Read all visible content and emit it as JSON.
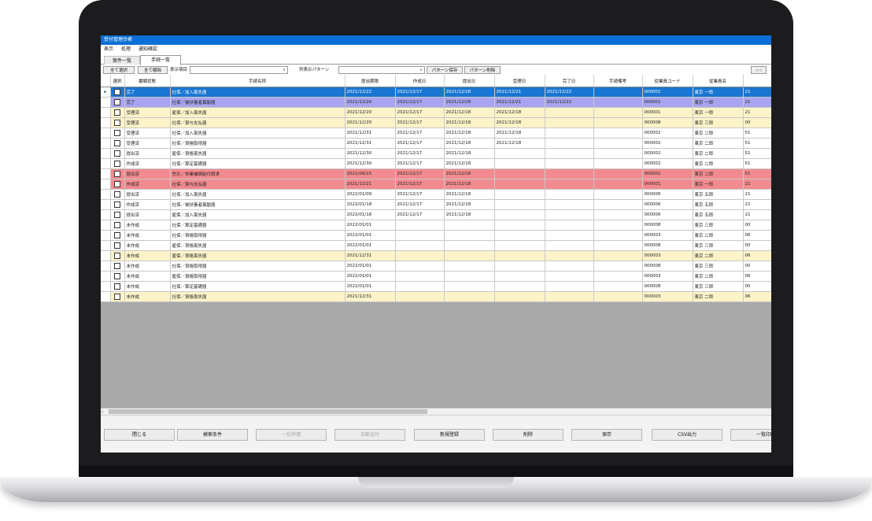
{
  "app": {
    "title": "受付管理台帳"
  },
  "menu": [
    "表示",
    "処理",
    "通知確認"
  ],
  "tabs": [
    {
      "label": "案件一覧",
      "active": false
    },
    {
      "label": "手続一覧",
      "active": true
    }
  ],
  "toolbar": {
    "select_all": "全て選択",
    "deselect_all": "全て解除",
    "display_item_label": "表示項目",
    "display_item_value": "",
    "column_pattern_label": "列表示パターン",
    "column_pattern_value": "",
    "save_pattern": "パターン保存",
    "delete_pattern": "パターン削除",
    "right_button": "<<"
  },
  "grid": {
    "columns": [
      "選択",
      "書類状態",
      "手続名称",
      "提出期限",
      "作成日",
      "提出日",
      "受理日",
      "完了日",
      "手続備考",
      "従業員コード",
      "従業員名",
      ""
    ],
    "rows": [
      {
        "style": "blue",
        "indicator": "▸",
        "status": "完了",
        "procedure": "社保／加入喪失届",
        "deadline": "2021/12/22",
        "created": "2021/12/17",
        "submitted": "2021/12/18",
        "accepted": "2021/12/21",
        "completed": "2021/12/22",
        "note": "",
        "code": "000001",
        "name": "東京 一郎",
        "extra": "21"
      },
      {
        "style": "purple",
        "indicator": "",
        "status": "完了",
        "procedure": "社保／被扶養者異動届",
        "deadline": "2021/12/20",
        "created": "2021/12/17",
        "submitted": "2021/12/18",
        "accepted": "2021/12/21",
        "completed": "2021/12/22",
        "note": "",
        "code": "000001",
        "name": "東京 一郎",
        "extra": "21"
      },
      {
        "style": "yellow",
        "indicator": "",
        "status": "受理済",
        "procedure": "雇保／加入喪失届",
        "deadline": "2021/12/20",
        "created": "2021/12/17",
        "submitted": "2021/12/18",
        "accepted": "2021/12/18",
        "completed": "",
        "note": "",
        "code": "000001",
        "name": "東京 一郎",
        "extra": "21"
      },
      {
        "style": "yellow",
        "indicator": "",
        "status": "受理済",
        "procedure": "社保／賞与支払届",
        "deadline": "2021/12/20",
        "created": "2021/12/17",
        "submitted": "2021/12/18",
        "accepted": "2021/12/18",
        "completed": "",
        "note": "",
        "code": "000008",
        "name": "東京 三郎",
        "extra": "00"
      },
      {
        "style": "white",
        "indicator": "",
        "status": "受理済",
        "procedure": "社保／加入喪失届",
        "deadline": "2021/12/31",
        "created": "2021/12/17",
        "submitted": "2021/12/18",
        "accepted": "2021/12/18",
        "completed": "",
        "note": "",
        "code": "000002",
        "name": "東京 二郎",
        "extra": "51"
      },
      {
        "style": "white",
        "indicator": "",
        "status": "受理済",
        "procedure": "社保／資格取得届",
        "deadline": "2021/12/31",
        "created": "2021/12/17",
        "submitted": "2021/12/18",
        "accepted": "2021/12/18",
        "completed": "",
        "note": "",
        "code": "000002",
        "name": "東京 二郎",
        "extra": "51"
      },
      {
        "style": "white",
        "indicator": "",
        "status": "提出済",
        "procedure": "雇保／資格喪失届",
        "deadline": "2021/12/30",
        "created": "2021/12/17",
        "submitted": "2021/12/18",
        "accepted": "",
        "completed": "",
        "note": "",
        "code": "000002",
        "name": "東京 二郎",
        "extra": "51"
      },
      {
        "style": "white",
        "indicator": "",
        "status": "作成済",
        "procedure": "社保／算定基礎届",
        "deadline": "2021/12/30",
        "created": "2021/12/17",
        "submitted": "2021/12/18",
        "accepted": "",
        "completed": "",
        "note": "",
        "code": "000002",
        "name": "東京 二郎",
        "extra": "51"
      },
      {
        "style": "red",
        "indicator": "",
        "status": "提出済",
        "procedure": "労災／休業補償給付請求",
        "deadline": "2021/09/15",
        "created": "2021/12/17",
        "submitted": "2021/12/18",
        "accepted": "",
        "completed": "",
        "note": "",
        "code": "000002",
        "name": "東京 二郎",
        "extra": "51"
      },
      {
        "style": "red",
        "indicator": "",
        "status": "作成済",
        "procedure": "社保／賞与支払届",
        "deadline": "2021/12/21",
        "created": "2021/12/17",
        "submitted": "2021/12/18",
        "accepted": "",
        "completed": "",
        "note": "",
        "code": "000001",
        "name": "東京 一郎",
        "extra": "21"
      },
      {
        "style": "white",
        "indicator": "",
        "status": "提出済",
        "procedure": "社保／加入喪失届",
        "deadline": "2022/01/09",
        "created": "2021/12/17",
        "submitted": "2021/12/18",
        "accepted": "",
        "completed": "",
        "note": "",
        "code": "000006",
        "name": "東京 五郎",
        "extra": "21"
      },
      {
        "style": "white",
        "indicator": "",
        "status": "作成済",
        "procedure": "社保／被扶養者異動届",
        "deadline": "2022/01/18",
        "created": "2021/12/17",
        "submitted": "2021/12/18",
        "accepted": "",
        "completed": "",
        "note": "",
        "code": "000006",
        "name": "東京 五郎",
        "extra": "21"
      },
      {
        "style": "white",
        "indicator": "",
        "status": "提出済",
        "procedure": "雇保／加入喪失届",
        "deadline": "2022/01/18",
        "created": "2021/12/17",
        "submitted": "2021/12/18",
        "accepted": "",
        "completed": "",
        "note": "",
        "code": "000006",
        "name": "東京 五郎",
        "extra": "21"
      },
      {
        "style": "white",
        "indicator": "",
        "status": "未作成",
        "procedure": "社保／算定基礎届",
        "deadline": "2022/01/01",
        "created": "",
        "submitted": "",
        "accepted": "",
        "completed": "",
        "note": "",
        "code": "000008",
        "name": "東京 三郎",
        "extra": "00"
      },
      {
        "style": "white",
        "indicator": "",
        "status": "未作成",
        "procedure": "社保／資格取得届",
        "deadline": "2022/01/01",
        "created": "",
        "submitted": "",
        "accepted": "",
        "completed": "",
        "note": "",
        "code": "000003",
        "name": "東京 二郎",
        "extra": "06"
      },
      {
        "style": "white",
        "indicator": "",
        "status": "未作成",
        "procedure": "雇保／資格喪失届",
        "deadline": "2022/01/01",
        "created": "",
        "submitted": "",
        "accepted": "",
        "completed": "",
        "note": "",
        "code": "000008",
        "name": "東京 三郎",
        "extra": "00"
      },
      {
        "style": "yellow",
        "indicator": "",
        "status": "未作成",
        "procedure": "雇保／資格喪失届",
        "deadline": "2021/12/31",
        "created": "",
        "submitted": "",
        "accepted": "",
        "completed": "",
        "note": "",
        "code": "000003",
        "name": "東京 二郎",
        "extra": "06"
      },
      {
        "style": "white",
        "indicator": "",
        "status": "未作成",
        "procedure": "社保／資格取得届",
        "deadline": "2022/01/01",
        "created": "",
        "submitted": "",
        "accepted": "",
        "completed": "",
        "note": "",
        "code": "000008",
        "name": "東京 三郎",
        "extra": "00"
      },
      {
        "style": "white",
        "indicator": "",
        "status": "未作成",
        "procedure": "雇保／資格取得届",
        "deadline": "2022/01/01",
        "created": "",
        "submitted": "",
        "accepted": "",
        "completed": "",
        "note": "",
        "code": "000003",
        "name": "東京 二郎",
        "extra": "06"
      },
      {
        "style": "white",
        "indicator": "",
        "status": "未作成",
        "procedure": "社保／算定基礎届",
        "deadline": "2022/01/01",
        "created": "",
        "submitted": "",
        "accepted": "",
        "completed": "",
        "note": "",
        "code": "000008",
        "name": "東京 三郎",
        "extra": "00"
      },
      {
        "style": "yellow",
        "indicator": "",
        "status": "未作成",
        "procedure": "社保／資格喪失届",
        "deadline": "2021/12/31",
        "created": "",
        "submitted": "",
        "accepted": "",
        "completed": "",
        "note": "",
        "code": "000003",
        "name": "東京 二郎",
        "extra": "06"
      }
    ]
  },
  "footer_buttons": [
    {
      "label": "閉じる",
      "enabled": true
    },
    {
      "label": "検索条件",
      "enabled": true
    },
    {
      "label": "一括申請",
      "enabled": false
    },
    {
      "label": "自動送付",
      "enabled": false
    },
    {
      "label": "新規登録",
      "enabled": true
    },
    {
      "label": "削除",
      "enabled": true
    },
    {
      "label": "保存",
      "enabled": true
    },
    {
      "label": "CSV出力",
      "enabled": true
    },
    {
      "label": "一覧印刷",
      "enabled": true
    }
  ],
  "colors": {
    "titlebar": "#0b6fd6",
    "row_blue": "#1976d2",
    "row_purple": "#a9a4ef",
    "row_yellow": "#fdf3c9",
    "row_red": "#f28b8f",
    "grid_empty": "#a9a9a9"
  }
}
